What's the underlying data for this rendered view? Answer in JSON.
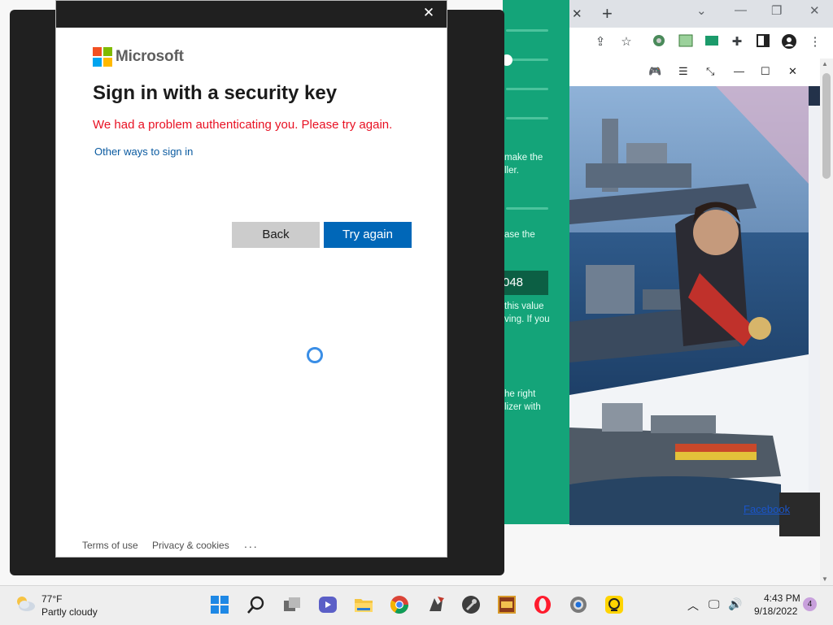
{
  "dialog": {
    "close_glyph": "✕",
    "brand": "Microsoft",
    "title": "Sign in with a security key",
    "error_message": "We had a problem authenticating you. Please try again.",
    "other_ways_link": "Other ways to sign in",
    "back_button": "Back",
    "try_again_button": "Try again",
    "footer": {
      "terms": "Terms of use",
      "privacy": "Privacy & cookies",
      "more": "..."
    }
  },
  "browser": {
    "tab_close_glyph": "✕",
    "new_tab_glyph": "+",
    "toolbar_icons": [
      "share-icon",
      "star-icon",
      "extension-icon",
      "extension-icon",
      "extension-icon",
      "puzzle-icon",
      "sidebar-icon",
      "profile-icon",
      "menu-icon"
    ]
  },
  "side_panel": {
    "text_lines": [
      "make the",
      "ller.",
      "ase the",
      "this value",
      "ving. If you",
      "he right",
      "lizer with"
    ],
    "code_value": "048"
  },
  "game_window": {
    "facebook_link": "Facebook"
  },
  "taskbar": {
    "weather_temp": "77°F",
    "weather_desc": "Partly cloudy",
    "pinned_apps": [
      "windows-start-icon",
      "search-icon",
      "task-view-icon",
      "teams-icon",
      "file-explorer-icon",
      "chrome-icon",
      "game-app-icon",
      "tools-icon",
      "dosbox-icon",
      "opera-icon",
      "settings-icon",
      "remote-app-icon"
    ],
    "time": "4:43 PM",
    "date": "9/18/2022",
    "notification_count": "4"
  },
  "colors": {
    "accent_blue": "#0067b8",
    "error_red": "#e81123",
    "link_blue": "#0a5aa0",
    "panel_green": "#14a479",
    "backdrop": "#202020"
  }
}
